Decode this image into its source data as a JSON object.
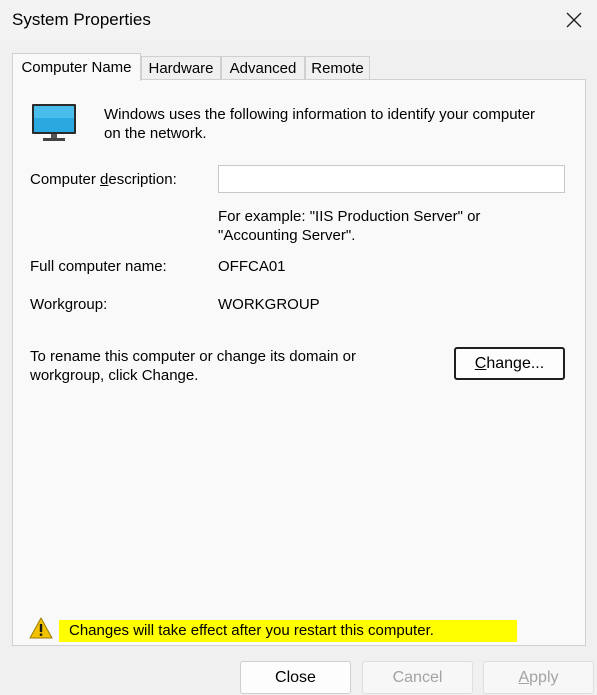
{
  "window": {
    "title": "System Properties"
  },
  "tabs": [
    {
      "label": "Computer Name",
      "active": true
    },
    {
      "label": "Hardware",
      "active": false
    },
    {
      "label": "Advanced",
      "active": false
    },
    {
      "label": "Remote",
      "active": false
    }
  ],
  "intro": {
    "line1": "Windows uses the following information to identify your computer",
    "line2": "on the network."
  },
  "description": {
    "label_before": "Computer ",
    "label_accel": "d",
    "label_after": "escription:",
    "value": "",
    "placeholder": ""
  },
  "example": {
    "line1": "For example: \"IIS Production Server\" or",
    "line2": "\"Accounting Server\"."
  },
  "full_name": {
    "label": "Full computer name:",
    "value": "OFFCA01"
  },
  "workgroup": {
    "label": "Workgroup:",
    "value": "WORKGROUP"
  },
  "rename": {
    "line1": "To rename this computer or change its domain or",
    "line2": "workgroup, click Change."
  },
  "change_button": {
    "accel": "C",
    "rest": "hange..."
  },
  "warning": {
    "text": "Changes will take effect after you restart this computer."
  },
  "footer": {
    "close_label": "Close",
    "cancel_label": "Cancel",
    "apply_accel": "A",
    "apply_rest": "pply"
  },
  "colors": {
    "warning_highlight": "#ffff00",
    "warning_icon": "#f2c200",
    "monitor_screen": "#29a9e0"
  }
}
